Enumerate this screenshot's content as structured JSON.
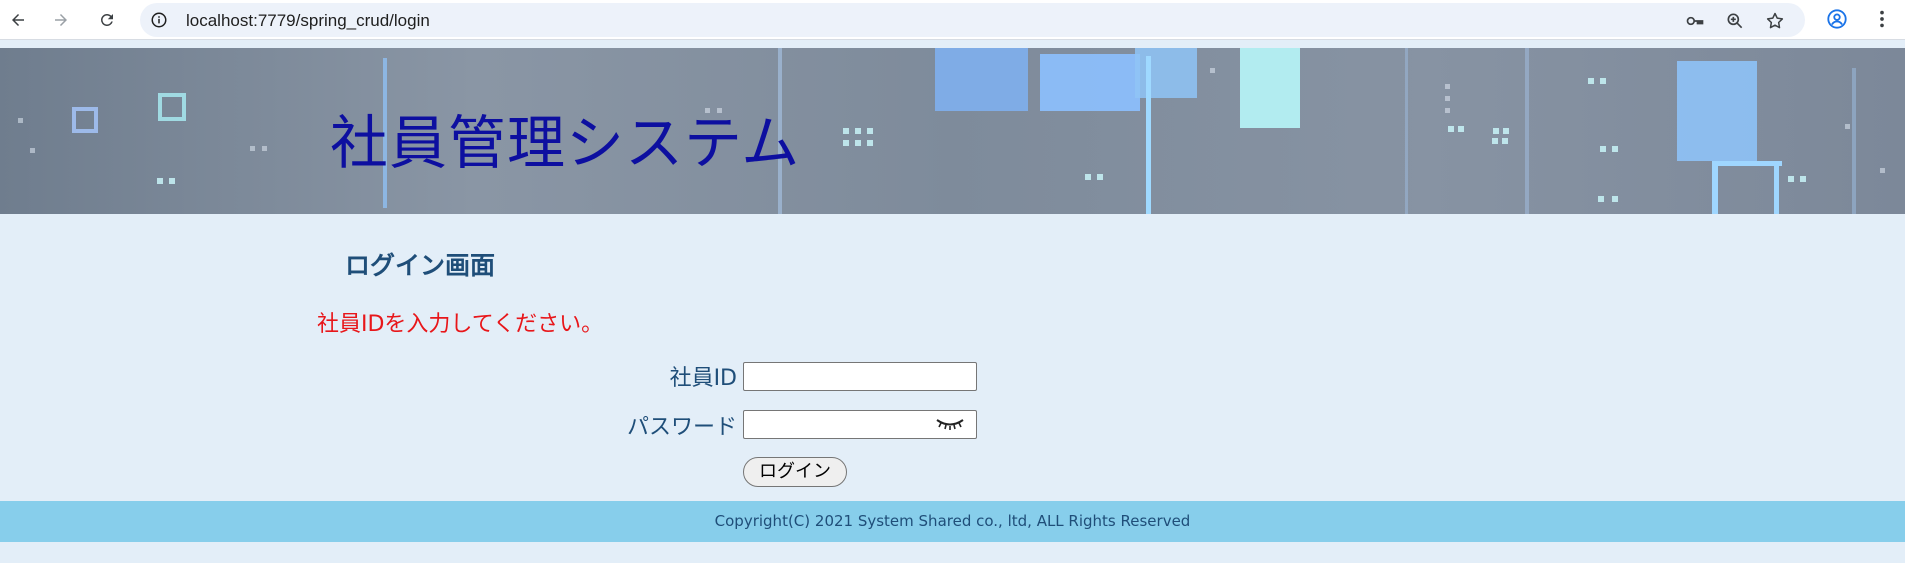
{
  "browser": {
    "url": "localhost:7779/spring_crud/login",
    "back_icon": "arrow-left-icon",
    "forward_icon": "arrow-right-icon",
    "reload_icon": "reload-icon",
    "site_info_icon": "info-icon",
    "password_key_icon": "key-icon",
    "zoom_icon": "zoom-in-icon",
    "bookmark_icon": "star-icon",
    "profile_icon": "profile-icon",
    "menu_icon": "kebab-menu-icon"
  },
  "header": {
    "title": "社員管理システム"
  },
  "main": {
    "heading": "ログイン画面",
    "error_message": "社員IDを入力してください。",
    "employee_id_label": "社員ID",
    "employee_id_value": "",
    "password_label": "パスワード",
    "password_value": "",
    "password_toggle_icon": "eye-closed-icon",
    "login_button": "ログイン"
  },
  "footer": {
    "copyright": "Copyright(C) 2021 System Shared co., ltd, ALL Rights Reserved"
  },
  "colors": {
    "title": "#0d0fa0",
    "heading": "#1f4e79",
    "error": "#e8161a",
    "page_background": "#e3eef8",
    "footer_background": "#87ceeb"
  }
}
